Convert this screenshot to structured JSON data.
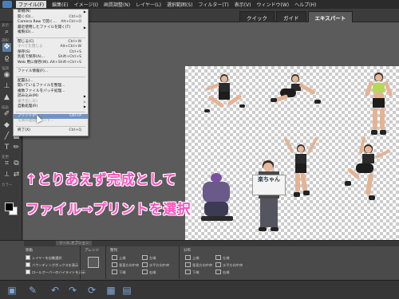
{
  "menubar": {
    "items": [
      "ファイル(F)",
      "編集(E)",
      "イメージ(I)",
      "画質調整(N)",
      "レイヤー(L)",
      "選択範囲(S)",
      "フィルター(T)",
      "表示(V)",
      "ウィンドウ(W)",
      "ヘルプ(H)"
    ],
    "active_index": 0
  },
  "mode_tabs": [
    "クイック",
    "ガイド",
    "エキスパート"
  ],
  "active_mode": "エキスパート",
  "file_menu": {
    "items": [
      {
        "label": "新規(N)",
        "shortcut": "",
        "submenu": true,
        "disabled": false
      },
      {
        "label": "開く(O)...",
        "shortcut": "Ctrl+O",
        "submenu": false,
        "disabled": false
      },
      {
        "label": "Camera Raw で開く...",
        "shortcut": "Alt+Ctrl+O",
        "submenu": false,
        "disabled": false
      },
      {
        "label": "最近使用したファイルを開く(T)",
        "shortcut": "",
        "submenu": true,
        "disabled": false
      },
      {
        "label": "複製(D)...",
        "shortcut": "",
        "submenu": false,
        "disabled": false
      },
      {
        "sep": true
      },
      {
        "label": "閉じる(C)",
        "shortcut": "Ctrl+W",
        "submenu": false,
        "disabled": false
      },
      {
        "label": "すべてを閉じる",
        "shortcut": "Alt+Ctrl+W",
        "submenu": false,
        "disabled": true
      },
      {
        "label": "保存(S)",
        "shortcut": "Ctrl+S",
        "submenu": false,
        "disabled": false
      },
      {
        "label": "別名で保存(A)...",
        "shortcut": "Shift+Ctrl+S",
        "submenu": false,
        "disabled": false
      },
      {
        "label": "Web 用に保存(W)...",
        "shortcut": "Alt+Shift+Ctrl+S",
        "submenu": false,
        "disabled": false
      },
      {
        "sep": true
      },
      {
        "label": "ファイル情報(F)...",
        "shortcut": "",
        "submenu": false,
        "disabled": false
      },
      {
        "sep": true
      },
      {
        "label": "配置(L)...",
        "shortcut": "",
        "submenu": false,
        "disabled": false
      },
      {
        "label": "開いているファイルを整理...",
        "shortcut": "",
        "submenu": false,
        "disabled": false
      },
      {
        "label": "複数ファイルをバッチ処理...",
        "shortcut": "",
        "submenu": false,
        "disabled": false
      },
      {
        "label": "読み込み(M)",
        "shortcut": "",
        "submenu": true,
        "disabled": false
      },
      {
        "label": "書き出し(E)",
        "shortcut": "",
        "submenu": true,
        "disabled": true
      },
      {
        "label": "自動処理(R)",
        "shortcut": "",
        "submenu": true,
        "disabled": false
      },
      {
        "sep": true
      },
      {
        "label": "プリント(P)...",
        "shortcut": "Ctrl+P",
        "submenu": false,
        "disabled": false,
        "highlight": true
      },
      {
        "label": "写真の連続プリント...",
        "shortcut": "",
        "submenu": false,
        "disabled": true
      },
      {
        "sep": true
      },
      {
        "label": "終了(X)",
        "shortcut": "Ctrl+Q",
        "submenu": false,
        "disabled": false
      }
    ]
  },
  "overlay": {
    "line1": "↑とりあえず完成として",
    "line2": "ファイル→プリントを選択"
  },
  "canvas": {
    "sign_text": "楽ちゃん"
  },
  "toolbox": {
    "sections": [
      "表示",
      "選択",
      "強調",
      "描画",
      "変更",
      "カラー"
    ]
  },
  "options_panel": {
    "tab_label": "ツール オプション",
    "sections": {
      "move": {
        "title": "移動",
        "checkboxes": [
          "レイヤーを自動選択",
          "バウンディングボックスを表示",
          "ロールオーバーのハイライトを表示"
        ]
      },
      "arrange": {
        "title": "アレンジ"
      },
      "align": {
        "title": "整列",
        "items": [
          "上端",
          "垂直方向中央",
          "下端",
          "左端",
          "水平方向中央",
          "右端"
        ]
      },
      "distribute": {
        "title": "分布",
        "items": [
          "上端",
          "垂直方向中央",
          "下端",
          "左端",
          "水平方向中央",
          "右端"
        ]
      }
    }
  },
  "colors": {
    "accent": "#6f94c2",
    "overlay_text": "#ff4fc1"
  }
}
